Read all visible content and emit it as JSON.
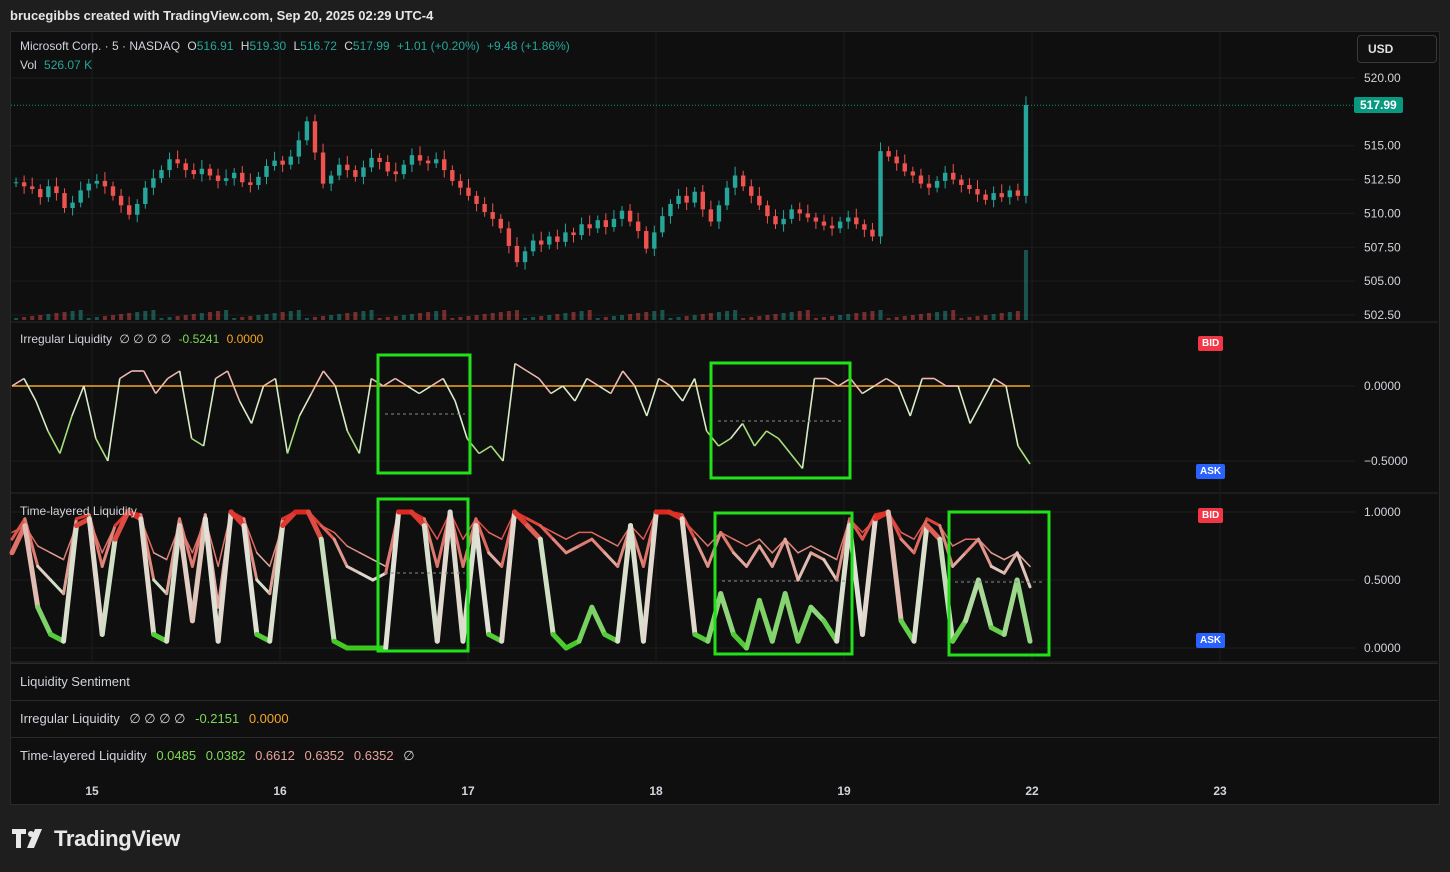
{
  "header": {
    "caption": "brucegibbs created with TradingView.com, Sep 20, 2025 02:29 UTC-4"
  },
  "currency_button": "USD",
  "price_legend": {
    "symbol": "Microsoft Corp. · 5 · NASDAQ",
    "o_label": "O",
    "o_value": "516.91",
    "h_label": "H",
    "h_value": "519.30",
    "l_label": "L",
    "l_value": "516.72",
    "c_label": "C",
    "c_value": "517.99",
    "change": "+1.01 (+0.20%)",
    "change2": "+9.48 (+1.86%)",
    "vol_label": "Vol",
    "vol_value": "526.07 K"
  },
  "last_price_tag": "517.99",
  "price_axis_ticks": [
    "520.00",
    "515.00",
    "512.50",
    "510.00",
    "507.50",
    "505.00",
    "502.50"
  ],
  "irregular_legend": {
    "name": "Irregular Liquidity",
    "marks": "∅ ∅ ∅ ∅",
    "v1": "-0.5241",
    "v2": "0.0000"
  },
  "irregular_axis_ticks": [
    "0.0000",
    "−0.5000"
  ],
  "time_legend": {
    "name": "Time-layered Liquidity"
  },
  "time_axis_ticks": [
    "1.0000",
    "0.5000",
    "0.0000"
  ],
  "bid_label": "BID",
  "ask_label": "ASK",
  "sentiment_row": {
    "name": "Liquidity Sentiment"
  },
  "irregular_row": {
    "name": "Irregular Liquidity",
    "marks": "∅ ∅ ∅ ∅",
    "v1": "-0.2151",
    "v2": "0.0000"
  },
  "time_row": {
    "name": "Time-layered Liquidity",
    "v1": "0.0485",
    "v2": "0.0382",
    "v3": "0.6612",
    "v4": "0.6352",
    "v5": "0.6352",
    "mark": "∅"
  },
  "time_axis_labels": [
    "15",
    "16",
    "17",
    "18",
    "19",
    "22",
    "23"
  ],
  "logo_text": "TradingView",
  "colors": {
    "up": "#26a69a",
    "down": "#ef5350",
    "box": "#22e01a",
    "accent_orange": "#f5a623",
    "bid": "#f23645",
    "ask": "#2962ff"
  },
  "chart_data": [
    {
      "type": "candlestick",
      "title": "Microsoft Corp. · 5 · NASDAQ",
      "x": [
        "15",
        "16",
        "17",
        "18",
        "19",
        "22",
        "23"
      ],
      "close_series": [
        512.3,
        512.0,
        511.8,
        511.2,
        512.0,
        511.5,
        510.4,
        510.8,
        511.7,
        512.2,
        512.4,
        512.0,
        511.3,
        510.6,
        509.9,
        510.7,
        511.9,
        512.6,
        513.2,
        514.0,
        513.7,
        513.2,
        512.9,
        513.3,
        512.8,
        512.4,
        512.6,
        513.0,
        512.3,
        512.1,
        512.7,
        513.5,
        513.9,
        513.6,
        514.2,
        515.4,
        516.8,
        514.5,
        512.2,
        512.8,
        513.6,
        513.2,
        512.7,
        513.4,
        514.1,
        513.8,
        513.1,
        512.9,
        513.6,
        514.3,
        513.9,
        513.7,
        514.0,
        513.2,
        512.4,
        511.9,
        511.3,
        510.7,
        510.1,
        509.6,
        508.9,
        507.6,
        506.4,
        507.2,
        508.0,
        507.7,
        508.3,
        507.9,
        508.6,
        508.4,
        509.2,
        508.9,
        509.5,
        509.0,
        509.6,
        510.2,
        509.4,
        508.7,
        507.4,
        508.6,
        509.8,
        510.7,
        511.3,
        510.8,
        511.6,
        510.3,
        509.4,
        510.6,
        511.9,
        512.8,
        512.0,
        511.3,
        510.6,
        509.8,
        509.2,
        509.6,
        510.3,
        510.0,
        509.7,
        509.4,
        509.1,
        508.9,
        509.4,
        509.7,
        509.2,
        508.8,
        508.3,
        514.6,
        514.2,
        513.7,
        513.1,
        512.8,
        512.2,
        511.9,
        512.4,
        513.0,
        512.5,
        512.1,
        511.8,
        511.4,
        511.0,
        511.5,
        511.2,
        511.7,
        511.3,
        518.0
      ]
    },
    {
      "type": "line",
      "title": "Irregular Liquidity",
      "ylim": [
        -0.6,
        0.15
      ],
      "series": [
        {
          "values": [
            0.0,
            0.05,
            -0.1,
            -0.3,
            -0.45,
            -0.2,
            0.0,
            -0.35,
            -0.5,
            0.05,
            0.1,
            0.1,
            -0.05,
            0.05,
            0.1,
            -0.35,
            -0.4,
            0.05,
            0.1,
            -0.1,
            -0.25,
            0.0,
            0.05,
            -0.45,
            -0.2,
            -0.05,
            0.1,
            0.0,
            -0.3,
            -0.45,
            0.05,
            0.0,
            0.05,
            0.0,
            -0.05,
            0.0,
            0.05,
            -0.1,
            -0.35,
            -0.45,
            -0.4,
            -0.5,
            0.15,
            0.1,
            0.05,
            -0.05,
            0.0,
            -0.1,
            0.05,
            0.0,
            -0.05,
            0.1,
            0.0,
            -0.2,
            0.05,
            0.0,
            -0.1,
            0.05,
            -0.3,
            -0.4,
            -0.35,
            -0.25,
            -0.4,
            -0.3,
            -0.35,
            -0.45,
            -0.55,
            0.05,
            0.05,
            0.0,
            0.05,
            -0.05,
            0.0,
            0.05,
            0.0,
            -0.2,
            0.05,
            0.05,
            0.0,
            0.0,
            -0.25,
            -0.1,
            0.05,
            0.0,
            -0.4,
            -0.52
          ]
        },
        {
          "values": [
            0.0,
            0.0
          ]
        }
      ]
    },
    {
      "type": "line",
      "title": "Time-layered Liquidity",
      "ylim": [
        0,
        1.0
      ],
      "series": [
        {
          "values": [
            0.7,
            0.9,
            0.3,
            0.1,
            0.05,
            0.9,
            0.95,
            0.1,
            0.8,
            1.0,
            0.95,
            0.1,
            0.05,
            0.9,
            0.2,
            0.95,
            0.05,
            1.0,
            0.9,
            0.1,
            0.05,
            0.9,
            1.0,
            1.0,
            0.8,
            0.05,
            0.0,
            0.0,
            0.0,
            0.0,
            1.0,
            1.0,
            0.9,
            0.05,
            1.0,
            0.05,
            0.9,
            0.1,
            0.05,
            1.0,
            0.9,
            0.8,
            0.1,
            0.0,
            0.05,
            0.3,
            0.1,
            0.05,
            0.9,
            0.05,
            1.0,
            1.0,
            0.95,
            0.1,
            0.05,
            0.4,
            0.1,
            0.0,
            0.35,
            0.05,
            0.4,
            0.05,
            0.3,
            0.2,
            0.05,
            0.9,
            0.1,
            0.95,
            1.0,
            0.2,
            0.05,
            0.9,
            0.8,
            0.05,
            0.2,
            0.5,
            0.15,
            0.1,
            0.5,
            0.05
          ]
        },
        {
          "values": [
            0.8,
            0.95,
            0.6,
            0.5,
            0.4,
            0.95,
            0.98,
            0.6,
            0.9,
            1.0,
            0.98,
            0.5,
            0.4,
            0.95,
            0.6,
            0.98,
            0.3,
            1.0,
            0.95,
            0.5,
            0.4,
            0.95,
            1.0,
            1.0,
            0.9,
            0.8,
            0.6,
            0.55,
            0.5,
            0.55,
            1.0,
            1.0,
            0.95,
            0.6,
            1.0,
            0.6,
            0.95,
            0.7,
            0.6,
            1.0,
            0.95,
            0.9,
            0.8,
            0.7,
            0.75,
            0.8,
            0.7,
            0.6,
            0.9,
            0.6,
            1.0,
            1.0,
            0.98,
            0.8,
            0.6,
            0.85,
            0.7,
            0.6,
            0.75,
            0.6,
            0.8,
            0.5,
            0.7,
            0.65,
            0.5,
            0.95,
            0.8,
            0.98,
            1.0,
            0.8,
            0.7,
            0.95,
            0.9,
            0.6,
            0.7,
            0.8,
            0.6,
            0.55,
            0.7,
            0.45
          ]
        },
        {
          "values": [
            0.85,
            0.9,
            0.75,
            0.7,
            0.65,
            0.9,
            0.95,
            0.7,
            0.9,
            1.0,
            0.95,
            0.7,
            0.65,
            0.9,
            0.7,
            0.95,
            0.6,
            1.0,
            0.95,
            0.7,
            0.6,
            0.9,
            1.0,
            1.0,
            0.9,
            0.85,
            0.75,
            0.7,
            0.65,
            0.6,
            1.0,
            1.0,
            0.95,
            0.8,
            1.0,
            0.8,
            0.95,
            0.85,
            0.8,
            1.0,
            0.95,
            0.9,
            0.85,
            0.8,
            0.85,
            0.85,
            0.8,
            0.75,
            0.9,
            0.8,
            1.0,
            1.0,
            0.95,
            0.85,
            0.75,
            0.85,
            0.8,
            0.75,
            0.8,
            0.7,
            0.8,
            0.7,
            0.75,
            0.7,
            0.65,
            0.95,
            0.85,
            0.95,
            1.0,
            0.85,
            0.8,
            0.95,
            0.9,
            0.75,
            0.8,
            0.8,
            0.7,
            0.65,
            0.7,
            0.6
          ]
        }
      ]
    }
  ]
}
